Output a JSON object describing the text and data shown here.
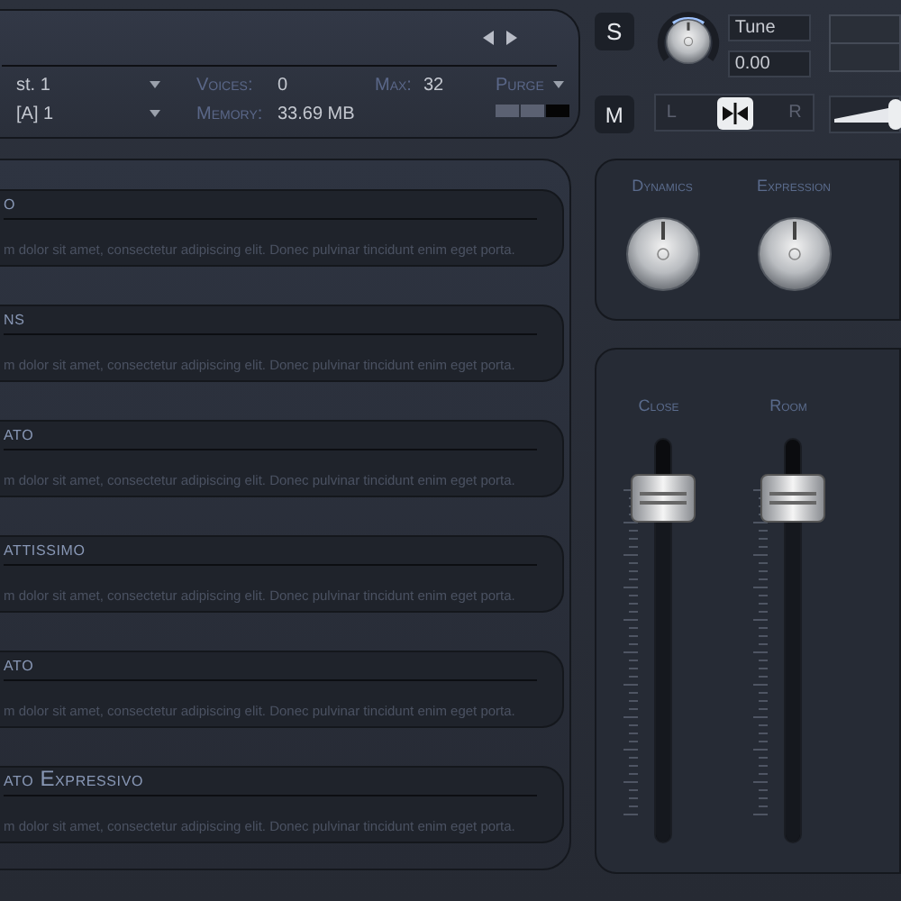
{
  "selectors": [
    {
      "value": "st. 1"
    },
    {
      "value": "[A] 1"
    }
  ],
  "stats": [
    {
      "label": "Voices:",
      "value": "0"
    },
    {
      "label": "Max:",
      "value": "32"
    },
    {
      "label": "Memory:",
      "value": "33.69 MB"
    }
  ],
  "purge": {
    "label": "Purge"
  },
  "solo": {
    "label": "S"
  },
  "mute": {
    "label": "M"
  },
  "tune": {
    "label": "Tune",
    "value": "0.00"
  },
  "pan": {
    "left": "L",
    "right": "R",
    "level": 0.5
  },
  "volume": {
    "level": 0.95
  },
  "articulations": [
    {
      "title": "o",
      "description": "m dolor sit amet, consectetur adipiscing elit. Donec pulvinar tincidunt enim eget porta."
    },
    {
      "title": "ns",
      "description": "m dolor sit amet, consectetur adipiscing elit. Donec pulvinar tincidunt enim eget porta."
    },
    {
      "title": "ato",
      "description": "m dolor sit amet, consectetur adipiscing elit. Donec pulvinar tincidunt enim eget porta."
    },
    {
      "title": "attissimo",
      "description": "m dolor sit amet, consectetur adipiscing elit. Donec pulvinar tincidunt enim eget porta."
    },
    {
      "title": "ato",
      "description": "m dolor sit amet, consectetur adipiscing elit. Donec pulvinar tincidunt enim eget porta."
    },
    {
      "title": "ato Expressivo",
      "description": "m dolor sit amet, consectetur adipiscing elit. Donec pulvinar tincidunt enim eget porta."
    }
  ],
  "knobs": [
    {
      "label": "Dynamics"
    },
    {
      "label": "Expression"
    }
  ],
  "faders": [
    {
      "label": "Close",
      "level": 0.85
    },
    {
      "label": "Room",
      "level": 0.85
    }
  ]
}
